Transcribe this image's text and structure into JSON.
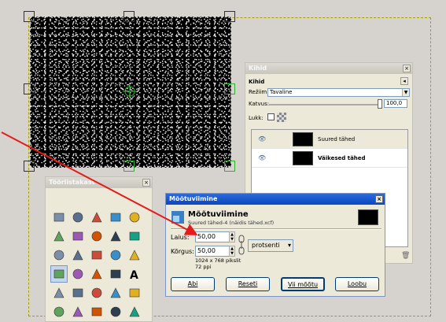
{
  "layers_dialog": {
    "window_title": "Kihid",
    "header": "Kihid",
    "mode_label": "Režiim:",
    "mode_value": "Tavaline",
    "opacity_label": "Katvus:",
    "opacity_value": "100,0",
    "lock_label": "Lukk:",
    "layers": [
      {
        "name": "Suured tähed",
        "selected": true
      },
      {
        "name": "Väikesed tähed",
        "selected": false
      }
    ]
  },
  "toolbox": {
    "window_title": "Tööriistakast",
    "icons": [
      "rect-select-icon",
      "ellipse-select-icon",
      "free-select-icon",
      "fuzzy-select-icon",
      "color-select-icon",
      "scissors-icon",
      "foreground-select-icon",
      "paths-icon",
      "color-picker-icon",
      "zoom-icon",
      "measure-icon",
      "move-icon",
      "align-icon",
      "crop-icon",
      "rotate-icon",
      "scale-icon",
      "shear-icon",
      "perspective-icon",
      "flip-icon",
      "text-icon",
      "bucket-fill-icon",
      "blend-icon",
      "pencil-icon",
      "paintbrush-icon",
      "eraser-icon",
      "airbrush-icon",
      "ink-icon",
      "clone-icon",
      "heal-icon",
      "smudge-icon"
    ]
  },
  "scale_dialog": {
    "window_title": "Mõõtuviimine",
    "heading": "Mõõtuviimine",
    "subheading": "Suured tähed-4 (näidis tähed.xcf)",
    "width_label": "Laius:",
    "width_value": "50,00",
    "height_label": "Kõrgus:",
    "height_value": "50,00",
    "unit": "protsenti",
    "size_info": "1024 x 768 pikslit",
    "ppi_info": "72 ppi",
    "buttons": {
      "help": "Abi",
      "reset": "Reseti",
      "scale": "Vii mõõtu",
      "cancel": "Loobu"
    }
  },
  "colors": {
    "titlebar_active": "#0a46c0",
    "annotation_arrow": "#e31b1b",
    "transform_handle": "#2fae2f",
    "layer_boundary": "#a8a000"
  }
}
